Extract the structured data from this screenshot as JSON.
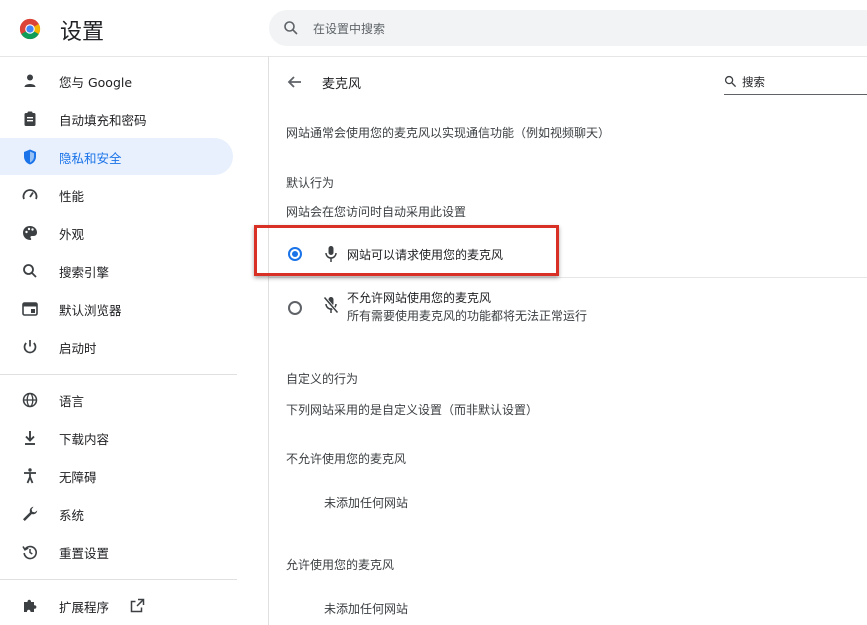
{
  "app": {
    "title": "设置"
  },
  "search": {
    "placeholder": "在设置中搜索"
  },
  "sidebar": {
    "items": [
      {
        "label": "您与 Google",
        "icon": "person-icon"
      },
      {
        "label": "自动填充和密码",
        "icon": "clipboard-icon"
      },
      {
        "label": "隐私和安全",
        "icon": "shield-icon",
        "active": true
      },
      {
        "label": "性能",
        "icon": "speedometer-icon"
      },
      {
        "label": "外观",
        "icon": "palette-icon"
      },
      {
        "label": "搜索引擎",
        "icon": "search-icon"
      },
      {
        "label": "默认浏览器",
        "icon": "browser-window-icon"
      },
      {
        "label": "启动时",
        "icon": "power-icon"
      },
      {
        "label": "语言",
        "icon": "globe-icon"
      },
      {
        "label": "下载内容",
        "icon": "download-icon"
      },
      {
        "label": "无障碍",
        "icon": "accessibility-icon"
      },
      {
        "label": "系统",
        "icon": "wrench-icon"
      },
      {
        "label": "重置设置",
        "icon": "reset-icon"
      },
      {
        "label": "扩展程序",
        "icon": "puzzle-icon",
        "external_icon": "open-external-icon"
      }
    ]
  },
  "page": {
    "title": "麦克风",
    "search_placeholder": "搜索",
    "description": "网站通常会使用您的麦克风以实现通信功能（例如视频聊天）",
    "default_behavior": {
      "heading": "默认行为",
      "subheading": "网站会在您访问时自动采用此设置",
      "options": [
        {
          "label": "网站可以请求使用您的麦克风",
          "icon": "microphone-icon",
          "checked": true
        },
        {
          "label": "不允许网站使用您的麦克风",
          "sublabel": "所有需要使用麦克风的功能都将无法正常运行",
          "icon": "microphone-off-icon",
          "checked": false
        }
      ]
    },
    "custom_behavior": {
      "heading": "自定义的行为",
      "subheading": "下列网站采用的是自定义设置（而非默认设置）",
      "blocked": {
        "heading": "不允许使用您的麦克风",
        "empty": "未添加任何网站"
      },
      "allowed": {
        "heading": "允许使用您的麦克风",
        "empty": "未添加任何网站"
      }
    }
  },
  "colors": {
    "accent": "#1a73e8",
    "highlight": "#d93025"
  }
}
